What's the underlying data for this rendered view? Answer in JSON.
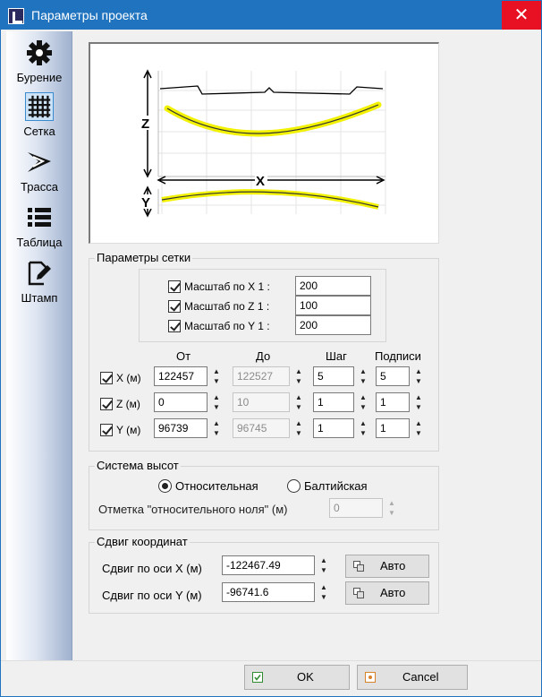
{
  "window": {
    "title": "Параметры проекта",
    "close_glyph": "✕"
  },
  "sidebar": {
    "items": [
      {
        "label": "Бурение",
        "icon": "gear-icon"
      },
      {
        "label": "Сетка",
        "icon": "grid-icon",
        "active": true
      },
      {
        "label": "Трасса",
        "icon": "route-icon"
      },
      {
        "label": "Таблица",
        "icon": "table-list-icon"
      },
      {
        "label": "Штамп",
        "icon": "stamp-edit-icon"
      }
    ]
  },
  "preview": {
    "label_z": "Z",
    "label_x": "X",
    "label_y": "Y"
  },
  "grid_params": {
    "title": "Параметры сетки",
    "scales": [
      {
        "label": "Масштаб по X  1 :",
        "value": "200",
        "checked": true
      },
      {
        "label": "Масштаб по Z  1 :",
        "value": "100",
        "checked": true
      },
      {
        "label": "Масштаб по Y  1 :",
        "value": "200",
        "checked": true
      }
    ],
    "headers": {
      "from": "От",
      "to": "До",
      "step": "Шаг",
      "labels": "Подписи"
    },
    "rows": [
      {
        "axis": "X (м)",
        "from": "122457",
        "to": "122527",
        "step": "5",
        "labels": "5",
        "checked": true
      },
      {
        "axis": "Z (м)",
        "from": "0",
        "to": "10",
        "step": "1",
        "labels": "1",
        "checked": true
      },
      {
        "axis": "Y (м)",
        "from": "96739",
        "to": "96745",
        "step": "1",
        "labels": "1",
        "checked": true
      }
    ]
  },
  "height_system": {
    "title": "Система высот",
    "option_relative": "Относительная",
    "option_baltic": "Балтийская",
    "selected": "relative",
    "zero_label": "Отметка \"относительного ноля\" (м)",
    "zero_value": "0"
  },
  "coord_shift": {
    "title": "Сдвиг координат",
    "x_label": "Сдвиг по оси X (м)",
    "x_value": "-122467.49",
    "y_label": "Сдвиг по оси Y (м)",
    "y_value": "-96741.6",
    "auto_label": "Авто"
  },
  "footer": {
    "ok_label": "OK",
    "cancel_label": "Cancel"
  },
  "colors": {
    "title_bar": "#1f73bf",
    "close": "#e81123",
    "curve_highlight": "#f2f200"
  }
}
